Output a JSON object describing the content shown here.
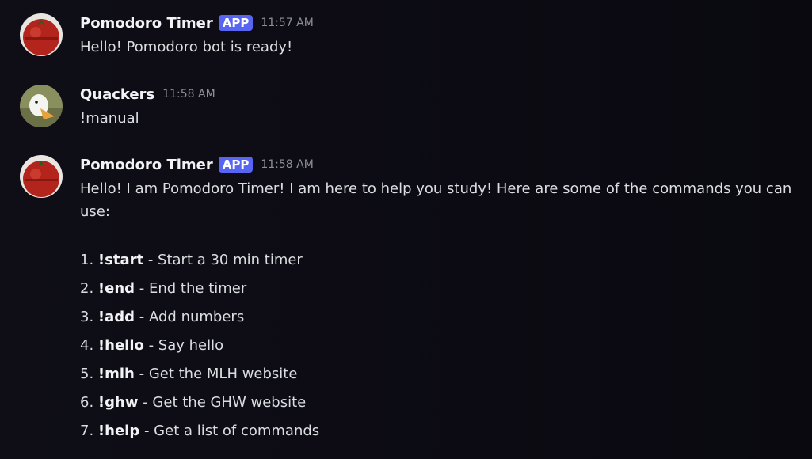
{
  "messages": [
    {
      "username": "Pomodoro Timer",
      "badge": "APP",
      "time": "11:57 AM",
      "avatar": "tomato-avatar",
      "text": "Hello! Pomodoro bot is ready!"
    },
    {
      "username": "Quackers",
      "time": "11:58 AM",
      "avatar": "duck-avatar",
      "text": "!manual"
    },
    {
      "username": "Pomodoro Timer",
      "badge": "APP",
      "time": "11:58 AM",
      "avatar": "tomato-avatar",
      "text": "Hello! I am Pomodoro Timer! I am here to help you study! Here are some of the commands you can use:",
      "commands": [
        {
          "num": "1.",
          "cmd": "!start",
          "desc": "- Start a 30 min timer"
        },
        {
          "num": "2.",
          "cmd": "!end",
          "desc": "- End the timer"
        },
        {
          "num": "3.",
          "cmd": "!add",
          "desc": "- Add numbers"
        },
        {
          "num": "4.",
          "cmd": "!hello",
          "desc": "- Say hello"
        },
        {
          "num": "5.",
          "cmd": "!mlh",
          "desc": "- Get the MLH website"
        },
        {
          "num": "6.",
          "cmd": "!ghw",
          "desc": "- Get the GHW website"
        },
        {
          "num": "7.",
          "cmd": "!help",
          "desc": "- Get a list of commands"
        }
      ]
    }
  ],
  "colors": {
    "background": "#0d0c14",
    "badge": "#5865f2",
    "username": "#f2f3f5",
    "text": "#dbdee1",
    "timestamp": "#8c8f99"
  }
}
